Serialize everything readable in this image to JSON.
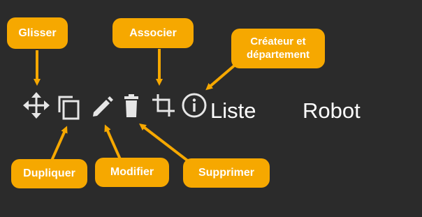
{
  "background_color": "#2b2b2b",
  "accent_color": "#f6a800",
  "icon_color": "#e6e6e6",
  "callouts": {
    "drag": "Glisser",
    "associate": "Associer",
    "creator_line1": "Créateur et",
    "creator_line2": "département",
    "duplicate": "Dupliquer",
    "edit": "Modifier",
    "delete": "Supprimer"
  },
  "toolbar": {
    "icons": [
      "move-icon",
      "copy-icon",
      "pencil-icon",
      "trash-icon",
      "crop-icon",
      "info-icon"
    ]
  },
  "columns": {
    "list": "Liste",
    "robot": "Robot"
  }
}
